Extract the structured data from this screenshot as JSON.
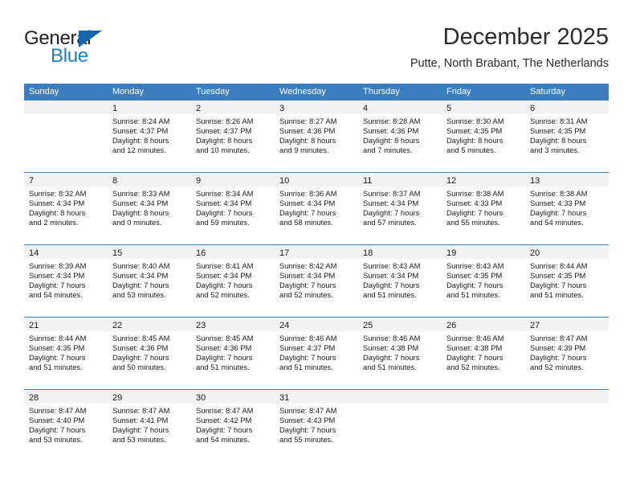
{
  "logo": {
    "word_top": "General",
    "word_bottom": "Blue",
    "triangle_color": "#1565b0",
    "blue_color": "#1b7fd4"
  },
  "header": {
    "month_title": "December 2025",
    "location": "Putte, North Brabant, The Netherlands"
  },
  "calendar": {
    "header_color": "#3a7ebf",
    "weekdays": [
      "Sunday",
      "Monday",
      "Tuesday",
      "Wednesday",
      "Thursday",
      "Friday",
      "Saturday"
    ],
    "weeks": [
      [
        {
          "day": "",
          "empty": true,
          "sunrise": "",
          "sunset": "",
          "daylight_line1": "",
          "daylight_line2": ""
        },
        {
          "day": "1",
          "sunrise": "Sunrise: 8:24 AM",
          "sunset": "Sunset: 4:37 PM",
          "daylight_line1": "Daylight: 8 hours",
          "daylight_line2": "and 12 minutes."
        },
        {
          "day": "2",
          "sunrise": "Sunrise: 8:26 AM",
          "sunset": "Sunset: 4:37 PM",
          "daylight_line1": "Daylight: 8 hours",
          "daylight_line2": "and 10 minutes."
        },
        {
          "day": "3",
          "sunrise": "Sunrise: 8:27 AM",
          "sunset": "Sunset: 4:36 PM",
          "daylight_line1": "Daylight: 8 hours",
          "daylight_line2": "and 9 minutes."
        },
        {
          "day": "4",
          "sunrise": "Sunrise: 8:28 AM",
          "sunset": "Sunset: 4:36 PM",
          "daylight_line1": "Daylight: 8 hours",
          "daylight_line2": "and 7 minutes."
        },
        {
          "day": "5",
          "sunrise": "Sunrise: 8:30 AM",
          "sunset": "Sunset: 4:35 PM",
          "daylight_line1": "Daylight: 8 hours",
          "daylight_line2": "and 5 minutes."
        },
        {
          "day": "6",
          "sunrise": "Sunrise: 8:31 AM",
          "sunset": "Sunset: 4:35 PM",
          "daylight_line1": "Daylight: 8 hours",
          "daylight_line2": "and 3 minutes."
        }
      ],
      [
        {
          "day": "7",
          "sunrise": "Sunrise: 8:32 AM",
          "sunset": "Sunset: 4:34 PM",
          "daylight_line1": "Daylight: 8 hours",
          "daylight_line2": "and 2 minutes."
        },
        {
          "day": "8",
          "sunrise": "Sunrise: 8:33 AM",
          "sunset": "Sunset: 4:34 PM",
          "daylight_line1": "Daylight: 8 hours",
          "daylight_line2": "and 0 minutes."
        },
        {
          "day": "9",
          "sunrise": "Sunrise: 8:34 AM",
          "sunset": "Sunset: 4:34 PM",
          "daylight_line1": "Daylight: 7 hours",
          "daylight_line2": "and 59 minutes."
        },
        {
          "day": "10",
          "sunrise": "Sunrise: 8:36 AM",
          "sunset": "Sunset: 4:34 PM",
          "daylight_line1": "Daylight: 7 hours",
          "daylight_line2": "and 58 minutes."
        },
        {
          "day": "11",
          "sunrise": "Sunrise: 8:37 AM",
          "sunset": "Sunset: 4:34 PM",
          "daylight_line1": "Daylight: 7 hours",
          "daylight_line2": "and 57 minutes."
        },
        {
          "day": "12",
          "sunrise": "Sunrise: 8:38 AM",
          "sunset": "Sunset: 4:33 PM",
          "daylight_line1": "Daylight: 7 hours",
          "daylight_line2": "and 55 minutes."
        },
        {
          "day": "13",
          "sunrise": "Sunrise: 8:38 AM",
          "sunset": "Sunset: 4:33 PM",
          "daylight_line1": "Daylight: 7 hours",
          "daylight_line2": "and 54 minutes."
        }
      ],
      [
        {
          "day": "14",
          "sunrise": "Sunrise: 8:39 AM",
          "sunset": "Sunset: 4:34 PM",
          "daylight_line1": "Daylight: 7 hours",
          "daylight_line2": "and 54 minutes."
        },
        {
          "day": "15",
          "sunrise": "Sunrise: 8:40 AM",
          "sunset": "Sunset: 4:34 PM",
          "daylight_line1": "Daylight: 7 hours",
          "daylight_line2": "and 53 minutes."
        },
        {
          "day": "16",
          "sunrise": "Sunrise: 8:41 AM",
          "sunset": "Sunset: 4:34 PM",
          "daylight_line1": "Daylight: 7 hours",
          "daylight_line2": "and 52 minutes."
        },
        {
          "day": "17",
          "sunrise": "Sunrise: 8:42 AM",
          "sunset": "Sunset: 4:34 PM",
          "daylight_line1": "Daylight: 7 hours",
          "daylight_line2": "and 52 minutes."
        },
        {
          "day": "18",
          "sunrise": "Sunrise: 8:43 AM",
          "sunset": "Sunset: 4:34 PM",
          "daylight_line1": "Daylight: 7 hours",
          "daylight_line2": "and 51 minutes."
        },
        {
          "day": "19",
          "sunrise": "Sunrise: 8:43 AM",
          "sunset": "Sunset: 4:35 PM",
          "daylight_line1": "Daylight: 7 hours",
          "daylight_line2": "and 51 minutes."
        },
        {
          "day": "20",
          "sunrise": "Sunrise: 8:44 AM",
          "sunset": "Sunset: 4:35 PM",
          "daylight_line1": "Daylight: 7 hours",
          "daylight_line2": "and 51 minutes."
        }
      ],
      [
        {
          "day": "21",
          "sunrise": "Sunrise: 8:44 AM",
          "sunset": "Sunset: 4:35 PM",
          "daylight_line1": "Daylight: 7 hours",
          "daylight_line2": "and 51 minutes."
        },
        {
          "day": "22",
          "sunrise": "Sunrise: 8:45 AM",
          "sunset": "Sunset: 4:36 PM",
          "daylight_line1": "Daylight: 7 hours",
          "daylight_line2": "and 50 minutes."
        },
        {
          "day": "23",
          "sunrise": "Sunrise: 8:45 AM",
          "sunset": "Sunset: 4:36 PM",
          "daylight_line1": "Daylight: 7 hours",
          "daylight_line2": "and 51 minutes."
        },
        {
          "day": "24",
          "sunrise": "Sunrise: 8:46 AM",
          "sunset": "Sunset: 4:37 PM",
          "daylight_line1": "Daylight: 7 hours",
          "daylight_line2": "and 51 minutes."
        },
        {
          "day": "25",
          "sunrise": "Sunrise: 8:46 AM",
          "sunset": "Sunset: 4:38 PM",
          "daylight_line1": "Daylight: 7 hours",
          "daylight_line2": "and 51 minutes."
        },
        {
          "day": "26",
          "sunrise": "Sunrise: 8:46 AM",
          "sunset": "Sunset: 4:38 PM",
          "daylight_line1": "Daylight: 7 hours",
          "daylight_line2": "and 52 minutes."
        },
        {
          "day": "27",
          "sunrise": "Sunrise: 8:47 AM",
          "sunset": "Sunset: 4:39 PM",
          "daylight_line1": "Daylight: 7 hours",
          "daylight_line2": "and 52 minutes."
        }
      ],
      [
        {
          "day": "28",
          "sunrise": "Sunrise: 8:47 AM",
          "sunset": "Sunset: 4:40 PM",
          "daylight_line1": "Daylight: 7 hours",
          "daylight_line2": "and 53 minutes."
        },
        {
          "day": "29",
          "sunrise": "Sunrise: 8:47 AM",
          "sunset": "Sunset: 4:41 PM",
          "daylight_line1": "Daylight: 7 hours",
          "daylight_line2": "and 53 minutes."
        },
        {
          "day": "30",
          "sunrise": "Sunrise: 8:47 AM",
          "sunset": "Sunset: 4:42 PM",
          "daylight_line1": "Daylight: 7 hours",
          "daylight_line2": "and 54 minutes."
        },
        {
          "day": "31",
          "sunrise": "Sunrise: 8:47 AM",
          "sunset": "Sunset: 4:43 PM",
          "daylight_line1": "Daylight: 7 hours",
          "daylight_line2": "and 55 minutes."
        },
        {
          "day": "",
          "empty": true,
          "sunrise": "",
          "sunset": "",
          "daylight_line1": "",
          "daylight_line2": ""
        },
        {
          "day": "",
          "empty": true,
          "sunrise": "",
          "sunset": "",
          "daylight_line1": "",
          "daylight_line2": ""
        },
        {
          "day": "",
          "empty": true,
          "sunrise": "",
          "sunset": "",
          "daylight_line1": "",
          "daylight_line2": ""
        }
      ]
    ]
  }
}
